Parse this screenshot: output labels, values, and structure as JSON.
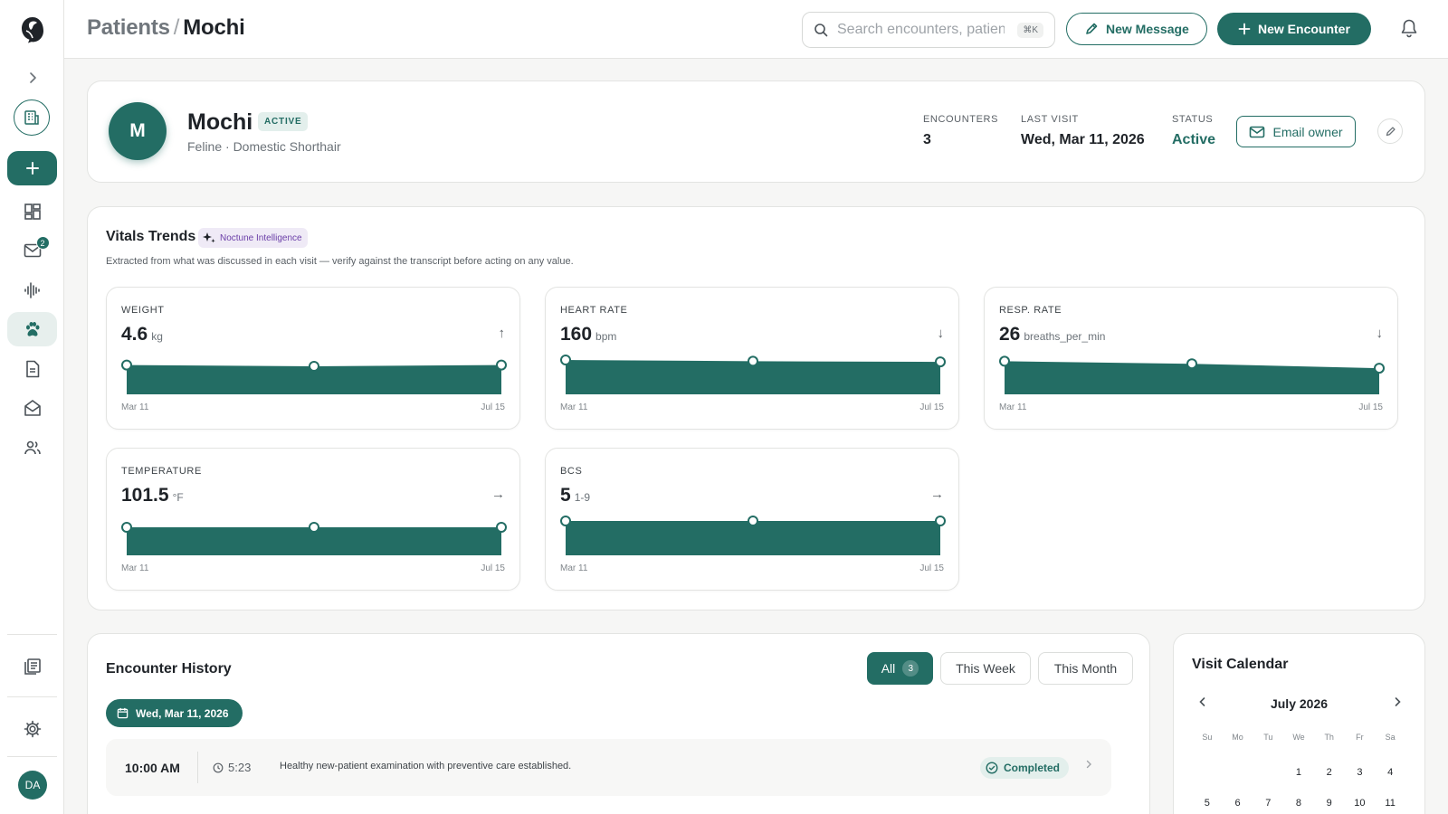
{
  "sidebar": {
    "nav_badge_count": "2",
    "avatar_initials": "DA"
  },
  "header": {
    "breadcrumb_parent": "Patients",
    "breadcrumb_separator": "/",
    "breadcrumb_current": "Mochi",
    "search_placeholder": "Search encounters, patients",
    "search_shortcut": "⌘K",
    "new_message_label": "New Message",
    "new_encounter_label": "New Encounter"
  },
  "patient": {
    "initial": "M",
    "name": "Mochi",
    "badge": "ACTIVE",
    "species": "Feline · Domestic Shorthair",
    "stats": {
      "encounters_label": "ENCOUNTERS",
      "encounters_value": "3",
      "last_visit_label": "LAST VISIT",
      "last_visit_value": "Wed, Mar 11, 2026",
      "status_label": "STATUS",
      "status_value": "Active"
    },
    "email_owner_label": "Email owner"
  },
  "vitals": {
    "title": "Vitals Trends",
    "ai_badge": "Noctune Intelligence",
    "subtitle": "Extracted from what was discussed in each visit — verify against the transcript before acting on any value.",
    "cards": [
      {
        "label": "WEIGHT",
        "value": "4.6",
        "unit": "kg",
        "trend": "↑",
        "start": "Mar 11",
        "end": "Jul 15",
        "points": [
          0.4,
          0.5,
          0.4
        ]
      },
      {
        "label": "HEART RATE",
        "value": "160",
        "unit": "bpm",
        "trend": "↓",
        "start": "Mar 11",
        "end": "Jul 15",
        "points": [
          0.0,
          0.1,
          0.15
        ]
      },
      {
        "label": "RESP. RATE",
        "value": "26",
        "unit": "breaths_per_min",
        "trend": "↓",
        "start": "Mar 11",
        "end": "Jul 15",
        "points": [
          0.1,
          0.3,
          0.65
        ]
      },
      {
        "label": "TEMPERATURE",
        "value": "101.5",
        "unit": "°F",
        "trend": "→",
        "start": "Mar 11",
        "end": "Jul 15",
        "points": [
          0.5,
          0.5,
          0.5
        ]
      },
      {
        "label": "BCS",
        "value": "5",
        "unit": "1-9",
        "trend": "→",
        "start": "Mar 11",
        "end": "Jul 15",
        "points": [
          0.0,
          0.0,
          0.0
        ]
      }
    ]
  },
  "encounters": {
    "title": "Encounter History",
    "filters": [
      {
        "label": "All",
        "count": "3"
      },
      {
        "label": "This Week"
      },
      {
        "label": "This Month"
      }
    ],
    "date_group": "Wed, Mar 11, 2026",
    "rows": [
      {
        "time": "10:00 AM",
        "duration": "5:23",
        "description": "Healthy new-patient examination with preventive care established.",
        "status": "Completed"
      }
    ]
  },
  "calendar": {
    "title": "Visit Calendar",
    "month": "July 2026",
    "weekdays": [
      "Su",
      "Mo",
      "Tu",
      "We",
      "Th",
      "Fr",
      "Sa"
    ],
    "days": [
      "",
      "",
      "",
      "1",
      "2",
      "3",
      "4",
      "5",
      "6",
      "7",
      "8",
      "9",
      "10",
      "11"
    ]
  },
  "colors": {
    "brand": "#236d64",
    "brand_light": "#e3efec",
    "ai_purple": "#6b3fa8"
  }
}
